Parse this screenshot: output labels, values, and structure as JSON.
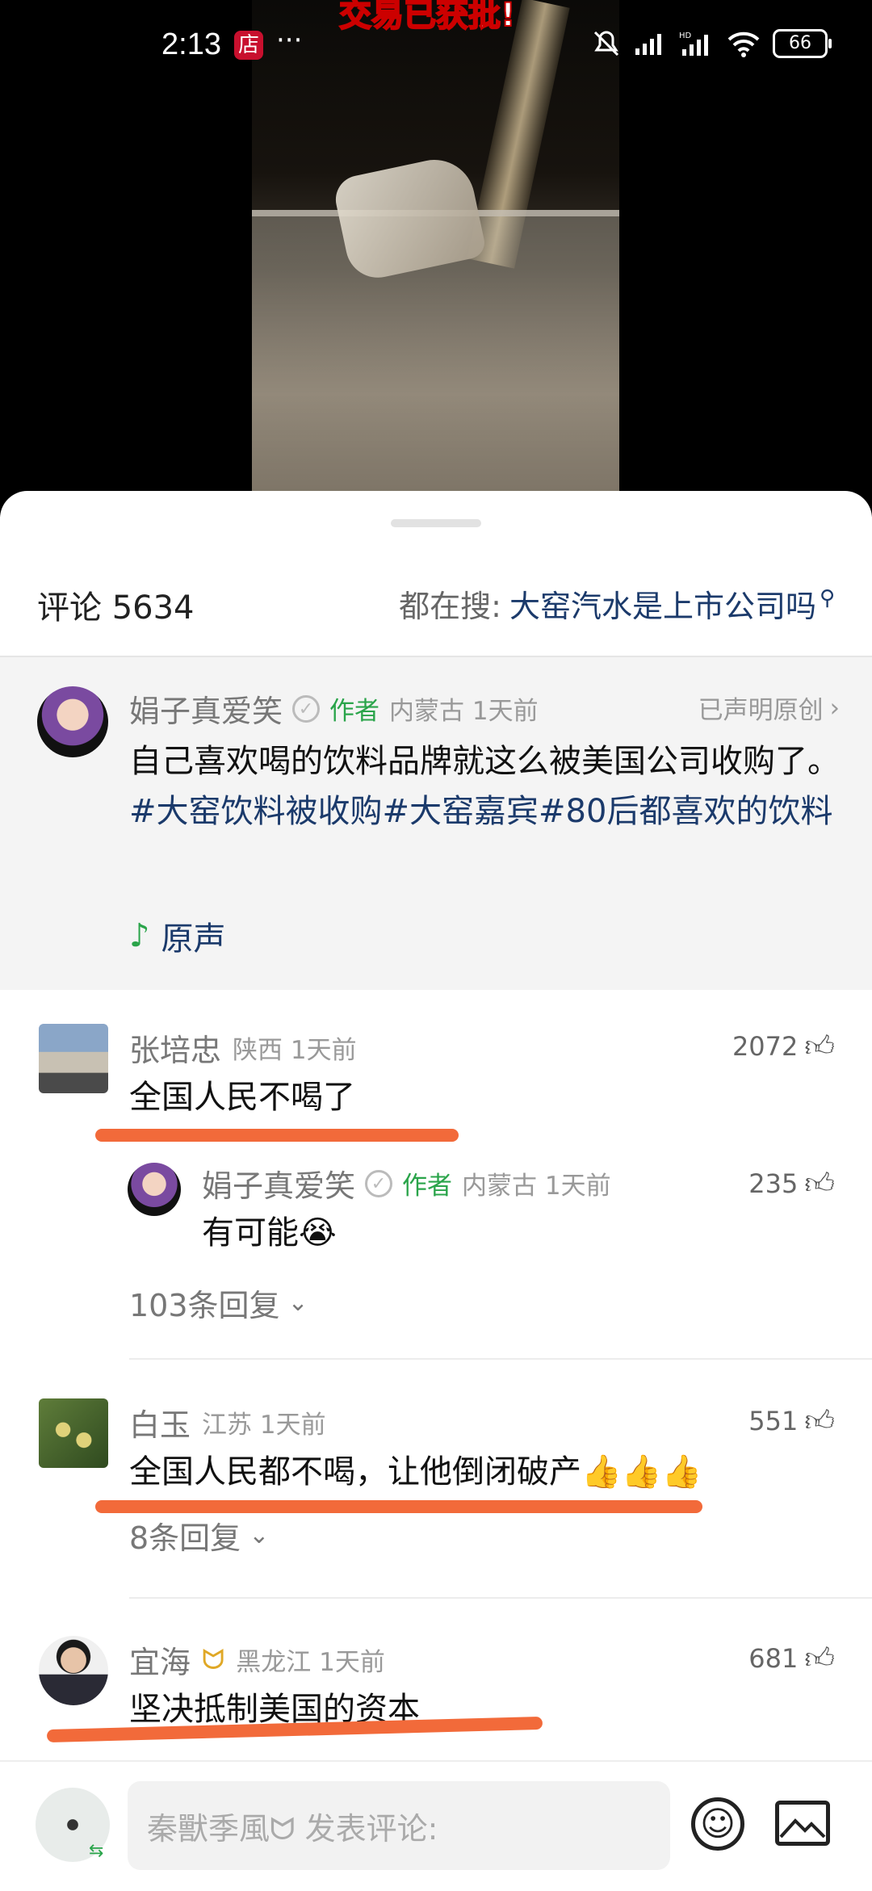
{
  "video": {
    "banner": "交易已获批!"
  },
  "status_bar": {
    "time": "2:13",
    "app_badge": "店",
    "more": "···",
    "net": "HD",
    "battery": "66"
  },
  "header": {
    "title": "评论 5634",
    "search_label": "都在搜:",
    "search_query": "大窑汽水是上市公司吗"
  },
  "author_post": {
    "name": "娟子真爱笑",
    "tag": "作者",
    "meta": "内蒙古 1天前",
    "declared": "已声明原创",
    "text_plain": "自己喜欢喝的饮料品牌就这么被美国公司收购了。",
    "hashtags": "#大窑饮料被收购#大窑嘉宾#80后都喜欢的饮料",
    "music_label": "原声"
  },
  "comments": [
    {
      "name": "张培忠",
      "meta": "陕西 1天前",
      "likes": "2072",
      "text": "全国人民不喝了",
      "reply": {
        "name": "娟子真爱笑",
        "tag": "作者",
        "meta": "内蒙古 1天前",
        "likes": "235",
        "text": "有可能😭"
      },
      "replies": "103条回复"
    },
    {
      "name": "白玉",
      "meta": "江苏 1天前",
      "likes": "551",
      "text": "全国人民都不喝，让他倒闭破产👍👍👍",
      "replies": "8条回复"
    },
    {
      "name": "宜海",
      "meta": "黑龙江 1天前",
      "likes": "681",
      "text": "坚决抵制美国的资本"
    }
  ],
  "bottom_bar": {
    "placeholder": "秦獸季風ᗢ 发表评论:"
  },
  "colors": {
    "accent_green": "#2aa44a",
    "hashtag_blue": "#1b3a6b",
    "highlight": "#f26a3a"
  }
}
